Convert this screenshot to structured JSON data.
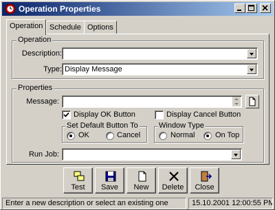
{
  "window": {
    "title": "Operation Properties",
    "app_icon": "clock-icon"
  },
  "tabs": [
    {
      "label": "Operation",
      "active": true
    },
    {
      "label": "Schedule",
      "active": false
    },
    {
      "label": "Options",
      "active": false
    }
  ],
  "operation_group": {
    "title": "Operation",
    "description_label": "Description:",
    "description_value": "",
    "type_label": "Type:",
    "type_value": "Display Message"
  },
  "properties_group": {
    "title": "Properties",
    "message_label": "Message:",
    "message_value": "",
    "display_ok_label": "Display OK Button",
    "display_ok_checked": true,
    "display_cancel_label": "Display Cancel Button",
    "display_cancel_checked": false,
    "default_button": {
      "title": "Set Default Button To",
      "options": [
        "OK",
        "Cancel"
      ],
      "selected": "OK"
    },
    "window_type": {
      "title": "Window Type",
      "options": [
        "Normal",
        "On Top"
      ],
      "selected": "On Top"
    },
    "run_job_label": "Run Job:",
    "run_job_value": ""
  },
  "toolbar": {
    "test_label": "Test",
    "save_label": "Save",
    "new_label": "New",
    "delete_label": "Delete",
    "close_label": "Close"
  },
  "statusbar": {
    "message": "Enter a new description or select an existing one",
    "datetime": "15.10.2001 12:00:55 PM"
  }
}
